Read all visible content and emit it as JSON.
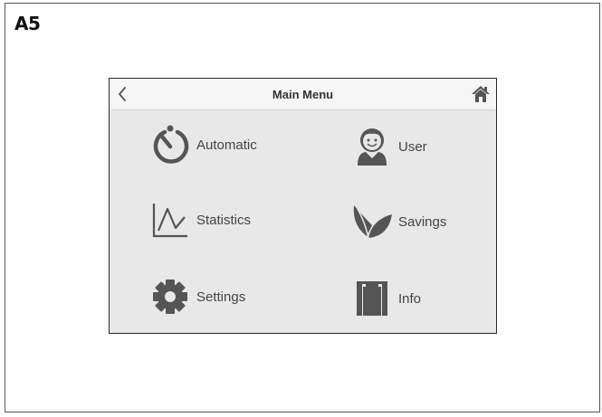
{
  "figure_label": "A5",
  "screen": {
    "title": "Main Menu",
    "back_icon": "chevron-left-icon",
    "home_icon": "home-icon",
    "colors": {
      "background": "#e8e8e8",
      "topbar": "#f6f6f6",
      "icon": "#555555",
      "text": "#444444"
    }
  },
  "menu": {
    "automatic": {
      "label": "Automatic",
      "icon": "timer-icon"
    },
    "user": {
      "label": "User",
      "icon": "user-icon"
    },
    "statistics": {
      "label": "Statistics",
      "icon": "chart-line-icon"
    },
    "savings": {
      "label": "Savings",
      "icon": "leaf-icon"
    },
    "settings": {
      "label": "Settings",
      "icon": "gear-icon"
    },
    "info": {
      "label": "Info",
      "icon": "info-panel-icon"
    }
  }
}
